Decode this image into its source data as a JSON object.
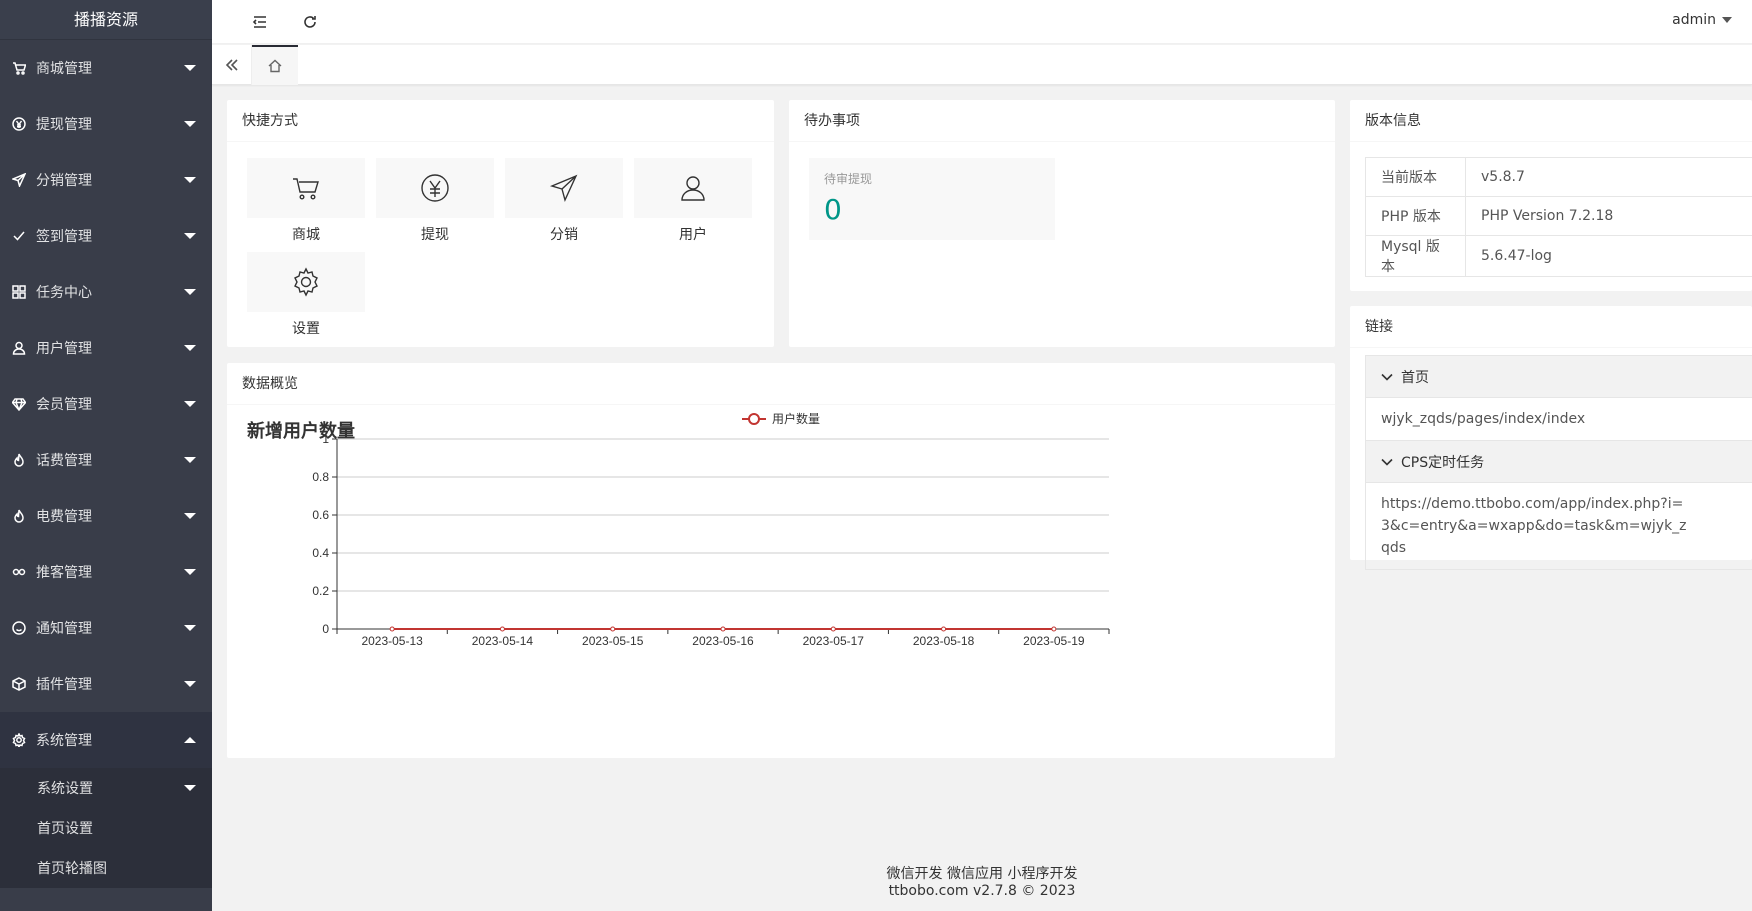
{
  "sidebar": {
    "logo": "播播资源",
    "items": [
      {
        "label": "商城管理",
        "icon": "cart-icon"
      },
      {
        "label": "提现管理",
        "icon": "yen-icon"
      },
      {
        "label": "分销管理",
        "icon": "send-icon"
      },
      {
        "label": "签到管理",
        "icon": "check-icon"
      },
      {
        "label": "任务中心",
        "icon": "apps-icon"
      },
      {
        "label": "用户管理",
        "icon": "user-icon"
      },
      {
        "label": "会员管理",
        "icon": "diamond-icon"
      },
      {
        "label": "话费管理",
        "icon": "fire-icon"
      },
      {
        "label": "电费管理",
        "icon": "fire-icon"
      },
      {
        "label": "推客管理",
        "icon": "link-icon"
      },
      {
        "label": "通知管理",
        "icon": "smile-icon"
      },
      {
        "label": "插件管理",
        "icon": "box-icon"
      },
      {
        "label": "系统管理",
        "icon": "gear-icon"
      }
    ],
    "subitems": [
      {
        "label": "系统设置"
      },
      {
        "label": "首页设置"
      },
      {
        "label": "首页轮播图"
      }
    ]
  },
  "topbar": {
    "user": "admin"
  },
  "shortcuts": {
    "title": "快捷方式",
    "items": [
      {
        "label": "商城",
        "icon": "cart-icon"
      },
      {
        "label": "提现",
        "icon": "yen-icon"
      },
      {
        "label": "分销",
        "icon": "send-icon"
      },
      {
        "label": "用户",
        "icon": "user-icon"
      },
      {
        "label": "设置",
        "icon": "gear-icon"
      }
    ]
  },
  "todo": {
    "title": "待办事项",
    "label": "待审提现",
    "count": "0"
  },
  "version": {
    "title": "版本信息",
    "rows": [
      {
        "key": "当前版本",
        "value": "v5.8.7"
      },
      {
        "key": "PHP 版本",
        "value": "PHP Version 7.2.18"
      },
      {
        "key": "Mysql 版本",
        "value": "5.6.47-log"
      }
    ]
  },
  "links": {
    "title": "链接",
    "groups": [
      {
        "name": "首页",
        "content": "wjyk_zqds/pages/index/index"
      },
      {
        "name": "CPS定时任务",
        "content": "https://demo.ttbobo.com/app/index.php?i=3&c=entry&a=wxapp&do=task&m=wjyk_zqds"
      }
    ]
  },
  "overview": {
    "title": "数据概览"
  },
  "chart_data": {
    "type": "line",
    "title": "新增用户数量",
    "x": [
      "2023-05-13",
      "2023-05-14",
      "2023-05-15",
      "2023-05-16",
      "2023-05-17",
      "2023-05-18",
      "2023-05-19"
    ],
    "series": [
      {
        "name": "用户数量",
        "values": [
          0,
          0,
          0,
          0,
          0,
          0,
          0
        ],
        "color": "#c23531"
      }
    ],
    "ylim": [
      0,
      1
    ],
    "yticks": [
      "0",
      "0.2",
      "0.4",
      "0.6",
      "0.8",
      "1"
    ],
    "grid": true,
    "legend": "top-center"
  },
  "footer": {
    "line1": "微信开发 微信应用 小程序开发",
    "line2": "ttbobo.com v2.7.8 © 2023"
  }
}
